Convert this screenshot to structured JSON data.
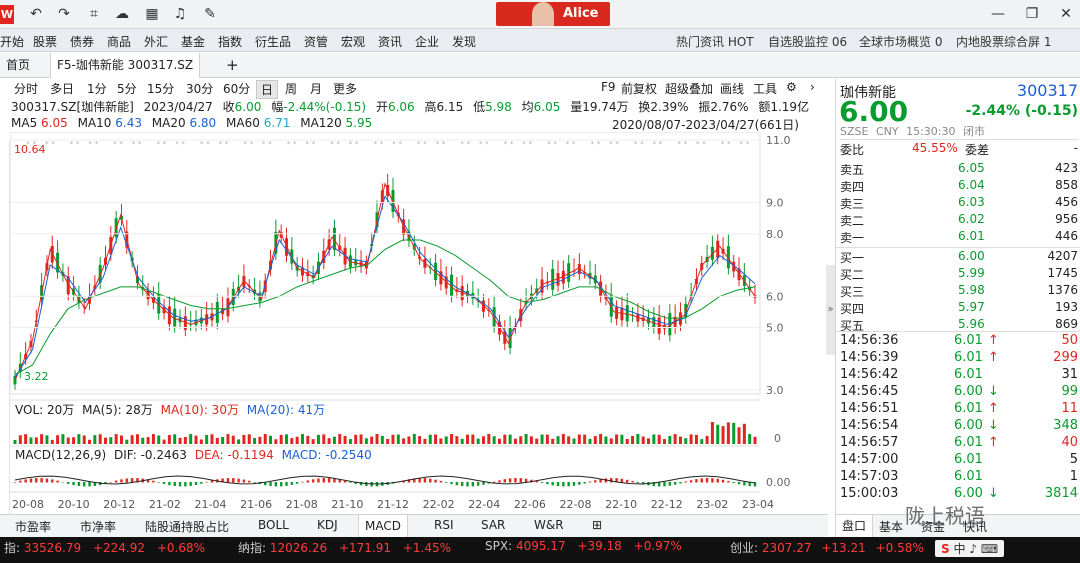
{
  "titlebar": {
    "logo": "W",
    "user": "Alice"
  },
  "menu": [
    "开始",
    "股票",
    "债券",
    "商品",
    "外汇",
    "基金",
    "指数",
    "衍生品",
    "资管",
    "宏观",
    "资讯",
    "企业",
    "发现"
  ],
  "menu_right": [
    "热门资讯 HOT",
    "自选股监控 06",
    "全球市场概览 0",
    "内地股票综合屏 1"
  ],
  "tabs": {
    "home": "首页",
    "active": "F5-珈伟新能 300317.SZ",
    "add": "+"
  },
  "periods": [
    "分时",
    "多日",
    "1分",
    "5分",
    "15分",
    "30分",
    "60分",
    "日",
    "周",
    "月",
    "更多"
  ],
  "period_selected": "日",
  "toolbar_right": [
    "F9",
    "前复权",
    "超级叠加",
    "画线",
    "工具"
  ],
  "info": {
    "code": "300317.SZ[珈伟新能]",
    "date": "2023/04/27",
    "close_lbl": "收",
    "close": "6.00",
    "chg_lbl": "幅",
    "chg": "-2.44%(-0.15)",
    "open_lbl": "开",
    "open": "6.06",
    "high_lbl": "高",
    "high": "6.15",
    "low_lbl": "低",
    "low": "5.98",
    "avg_lbl": "均",
    "avg": "6.05",
    "vol_lbl": "量",
    "vol": "19.74万",
    "turn_lbl": "换",
    "turn": "2.39%",
    "amp_lbl": "振",
    "amp": "2.76%",
    "amt_lbl": "额",
    "amt": "1.19亿"
  },
  "ma": {
    "ma5": "MA5",
    "ma5v": "6.05",
    "ma10": "MA10",
    "ma10v": "6.43",
    "ma20": "MA20",
    "ma20v": "6.80",
    "ma60": "MA60",
    "ma60v": "6.71",
    "ma120": "MA120",
    "ma120v": "5.95"
  },
  "range": "2020/08/07-2023/04/27(661日)",
  "vol_legend": {
    "vol": "VOL: 20万",
    "ma5": "MA(5): 28万",
    "ma10": "MA(10): 30万",
    "ma20": "MA(20): 41万"
  },
  "macd_legend": {
    "macd": "MACD(12,26,9)",
    "dif": "DIF: -0.2463",
    "dea": "DEA: -0.1194",
    "macdv": "MACD: -0.2540"
  },
  "chart_data": {
    "type": "line",
    "title": "",
    "xlabel": "",
    "ylabel": "",
    "price_ticks": [
      "11.0",
      "9.0",
      "8.0",
      "6.0",
      "5.0",
      "3.0"
    ],
    "vol_ticks": [
      "0"
    ],
    "macd_ticks": [
      "0.00"
    ],
    "x_ticks": [
      "20-08",
      "20-10",
      "20-12",
      "21-02",
      "21-04",
      "21-06",
      "21-08",
      "21-10",
      "21-12",
      "22-02",
      "22-04",
      "22-06",
      "22-08",
      "22-10",
      "22-12",
      "23-02",
      "23-04"
    ],
    "max_label": "10.64",
    "min_label": "3.22",
    "ylim": [
      3.0,
      11.0
    ],
    "series": [
      {
        "name": "MA5",
        "color": "#e0271f",
        "values": [
          3.3,
          4.6,
          7.5,
          6.4,
          5.6,
          6.9,
          8.6,
          6.4,
          5.8,
          5.3,
          5.1,
          5.3,
          5.6,
          6.5,
          5.9,
          8.1,
          6.9,
          6.6,
          7.9,
          7.1,
          7.0,
          9.6,
          8.3,
          7.2,
          6.7,
          6.2,
          6.0,
          5.5,
          4.5,
          5.8,
          6.4,
          6.6,
          6.9,
          6.5,
          5.5,
          5.4,
          5.2,
          5.0,
          5.4,
          7.0,
          7.6,
          6.8,
          6.0
        ]
      },
      {
        "name": "MA10",
        "color": "#1c5fd6",
        "values": [
          3.4,
          4.3,
          7.0,
          6.6,
          5.8,
          6.6,
          8.2,
          6.6,
          5.9,
          5.4,
          5.2,
          5.3,
          5.6,
          6.3,
          6.0,
          7.8,
          7.0,
          6.7,
          7.6,
          7.2,
          7.1,
          9.2,
          8.4,
          7.4,
          6.8,
          6.3,
          6.0,
          5.6,
          4.7,
          5.6,
          6.3,
          6.5,
          6.8,
          6.5,
          5.7,
          5.5,
          5.3,
          5.1,
          5.3,
          6.6,
          7.3,
          6.9,
          6.4
        ]
      },
      {
        "name": "MA60",
        "color": "#0a9b2e",
        "values": [
          3.5,
          3.8,
          4.8,
          5.6,
          5.9,
          6.1,
          6.3,
          6.3,
          6.1,
          5.9,
          5.7,
          5.6,
          5.6,
          5.7,
          5.8,
          6.0,
          6.3,
          6.5,
          6.7,
          6.9,
          7.0,
          7.5,
          7.8,
          7.8,
          7.6,
          7.3,
          6.9,
          6.5,
          6.0,
          5.8,
          5.9,
          6.1,
          6.3,
          6.3,
          6.0,
          5.8,
          5.5,
          5.3,
          5.3,
          5.6,
          6.0,
          6.2,
          6.3
        ]
      }
    ]
  },
  "quote": {
    "name": "珈伟新能",
    "code": "300317",
    "price": "6.00",
    "chg": "-2.44% (-0.15)",
    "exch": "SZSE",
    "cur": "CNY",
    "time": "15:30:30",
    "status": "闭市",
    "weibi_lbl": "委比",
    "weibi": "45.55%",
    "weicha_lbl": "委差",
    "weicha": "-"
  },
  "asks": [
    {
      "l": "卖五",
      "p": "6.05",
      "v": "423"
    },
    {
      "l": "卖四",
      "p": "6.04",
      "v": "858"
    },
    {
      "l": "卖三",
      "p": "6.03",
      "v": "456"
    },
    {
      "l": "卖二",
      "p": "6.02",
      "v": "956"
    },
    {
      "l": "卖一",
      "p": "6.01",
      "v": "446"
    }
  ],
  "bids": [
    {
      "l": "买一",
      "p": "6.00",
      "v": "4207"
    },
    {
      "l": "买二",
      "p": "5.99",
      "v": "1745"
    },
    {
      "l": "买三",
      "p": "5.98",
      "v": "1376"
    },
    {
      "l": "买四",
      "p": "5.97",
      "v": "193"
    },
    {
      "l": "买五",
      "p": "5.96",
      "v": "869"
    }
  ],
  "trades": [
    {
      "t": "14:56:36",
      "p": "6.01",
      "d": "up",
      "v": "50"
    },
    {
      "t": "14:56:39",
      "p": "6.01",
      "d": "up",
      "v": "299"
    },
    {
      "t": "14:56:42",
      "p": "6.01",
      "d": "",
      "v": "31"
    },
    {
      "t": "14:56:45",
      "p": "6.00",
      "d": "down",
      "v": "99"
    },
    {
      "t": "14:56:51",
      "p": "6.01",
      "d": "up",
      "v": "11"
    },
    {
      "t": "14:56:54",
      "p": "6.00",
      "d": "down",
      "v": "348"
    },
    {
      "t": "14:56:57",
      "p": "6.01",
      "d": "up",
      "v": "40"
    },
    {
      "t": "14:57:00",
      "p": "6.01",
      "d": "",
      "v": "5"
    },
    {
      "t": "14:57:03",
      "p": "6.01",
      "d": "",
      "v": "1"
    },
    {
      "t": "15:00:03",
      "p": "6.00",
      "d": "down",
      "v": "3814"
    }
  ],
  "bottom_tabs": [
    "市盈率",
    "市净率",
    "陆股通持股占比",
    "BOLL",
    "KDJ",
    "MACD",
    "RSI",
    "SAR",
    "W&R"
  ],
  "bottom_selected": "MACD",
  "right_tabs": [
    "盘口",
    "基本",
    "资金",
    "快讯"
  ],
  "watermark": "陇上税语",
  "ticker": [
    {
      "lbl": "指:",
      "v": "33526.79",
      "c": "+224.92",
      "p": "+0.68%"
    },
    {
      "lbl": "纳指:",
      "v": "12026.26",
      "c": "+171.91",
      "p": "+1.45%"
    },
    {
      "lbl": "SPX:",
      "v": "4095.17",
      "c": "+39.18",
      "p": "+0.97%"
    },
    {
      "lbl": "创业:",
      "v": "2307.27",
      "c": "+13.21",
      "p": "+0.58%"
    }
  ]
}
